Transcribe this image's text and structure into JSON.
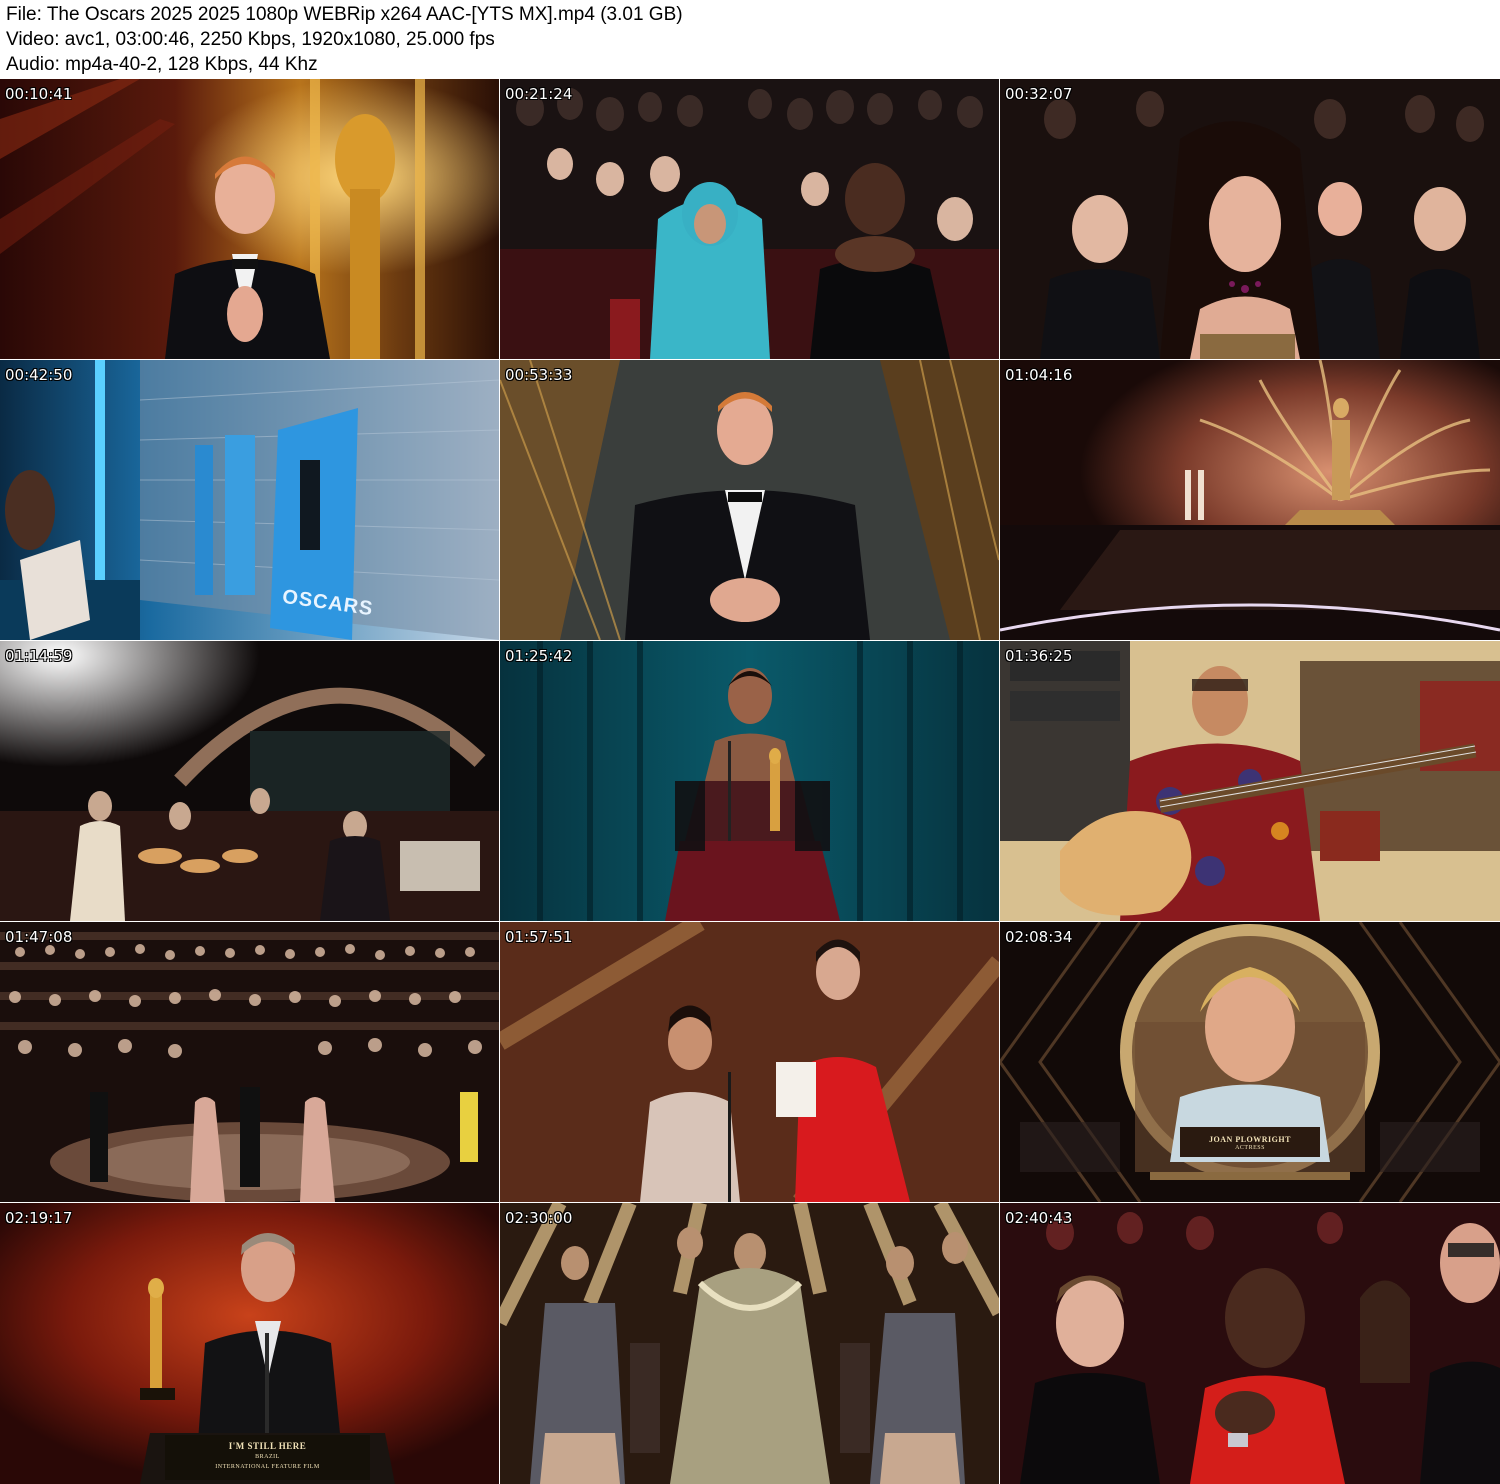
{
  "header": {
    "file_line": "File: The Oscars 2025 2025 1080p WEBRip x264 AAC-[YTS MX].mp4 (3.01 GB)",
    "video_line": "Video: avc1, 03:00:46, 2250 Kbps, 1920x1080, 25.000 fps",
    "audio_line": "Audio: mp4a-40-2, 128 Kbps, 44 Khz"
  },
  "thumbnails": [
    {
      "timestamp": "00:10:41"
    },
    {
      "timestamp": "00:21:24"
    },
    {
      "timestamp": "00:32:07"
    },
    {
      "timestamp": "00:42:50",
      "poster_text": "OSCARS"
    },
    {
      "timestamp": "00:53:33"
    },
    {
      "timestamp": "01:04:16"
    },
    {
      "timestamp": "01:14:59"
    },
    {
      "timestamp": "01:25:42"
    },
    {
      "timestamp": "01:36:25"
    },
    {
      "timestamp": "01:47:08"
    },
    {
      "timestamp": "01:57:51"
    },
    {
      "timestamp": "02:08:34",
      "lower_third_name": "JOAN PLOWRIGHT",
      "lower_third_role": "ACTRESS"
    },
    {
      "timestamp": "02:19:17",
      "lower_third_name": "I'M STILL HERE",
      "lower_third_role": "BRAZIL",
      "lower_third_category": "INTERNATIONAL FEATURE FILM"
    },
    {
      "timestamp": "02:30:00"
    },
    {
      "timestamp": "02:40:43"
    }
  ]
}
